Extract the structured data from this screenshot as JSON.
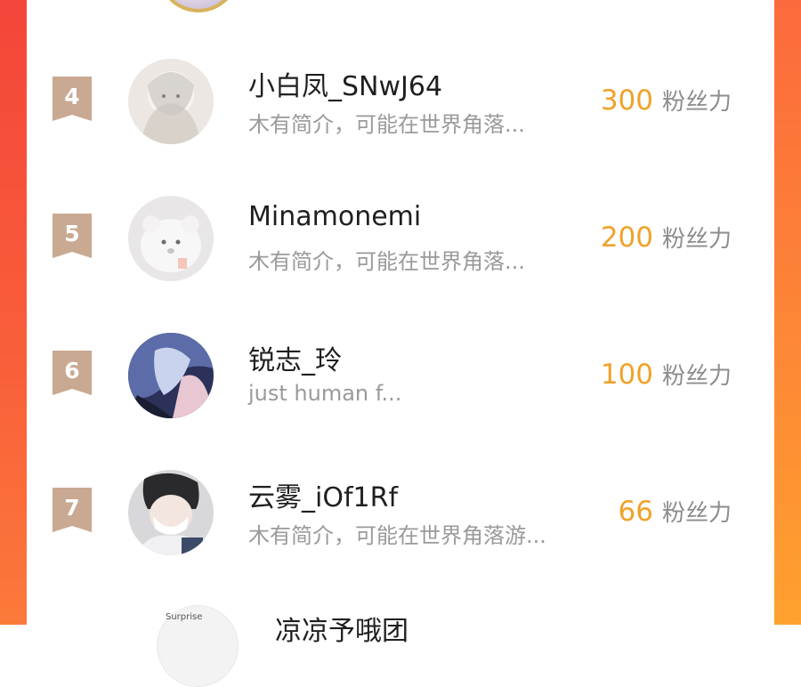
{
  "leaderboard": {
    "entries": [
      {
        "rank": "4",
        "username": "小白凤_SNwJ64",
        "bio": "木有简介，可能在世界角落...",
        "fans_value": "300",
        "fans_unit": "粉丝力"
      },
      {
        "rank": "5",
        "username": "Minamonemi",
        "bio": "木有简介，可能在世界角落...",
        "fans_value": "200",
        "fans_unit": "粉丝力"
      },
      {
        "rank": "6",
        "username": "锐志_玲",
        "bio": "just human f...",
        "fans_value": "100",
        "fans_unit": "粉丝力"
      },
      {
        "rank": "7",
        "username": "云雾_iOf1Rf",
        "bio": "木有简介，可能在世界角落游...",
        "fans_value": "66",
        "fans_unit": "粉丝力"
      }
    ],
    "partial_entry": {
      "username": "凉凉予哦团",
      "avatar_text": "Surprise"
    }
  },
  "colors": {
    "badge": "#c9a992",
    "fans_value": "#f0a22a",
    "gradient_left": "#f4453a",
    "gradient_right": "#ffa12e"
  }
}
